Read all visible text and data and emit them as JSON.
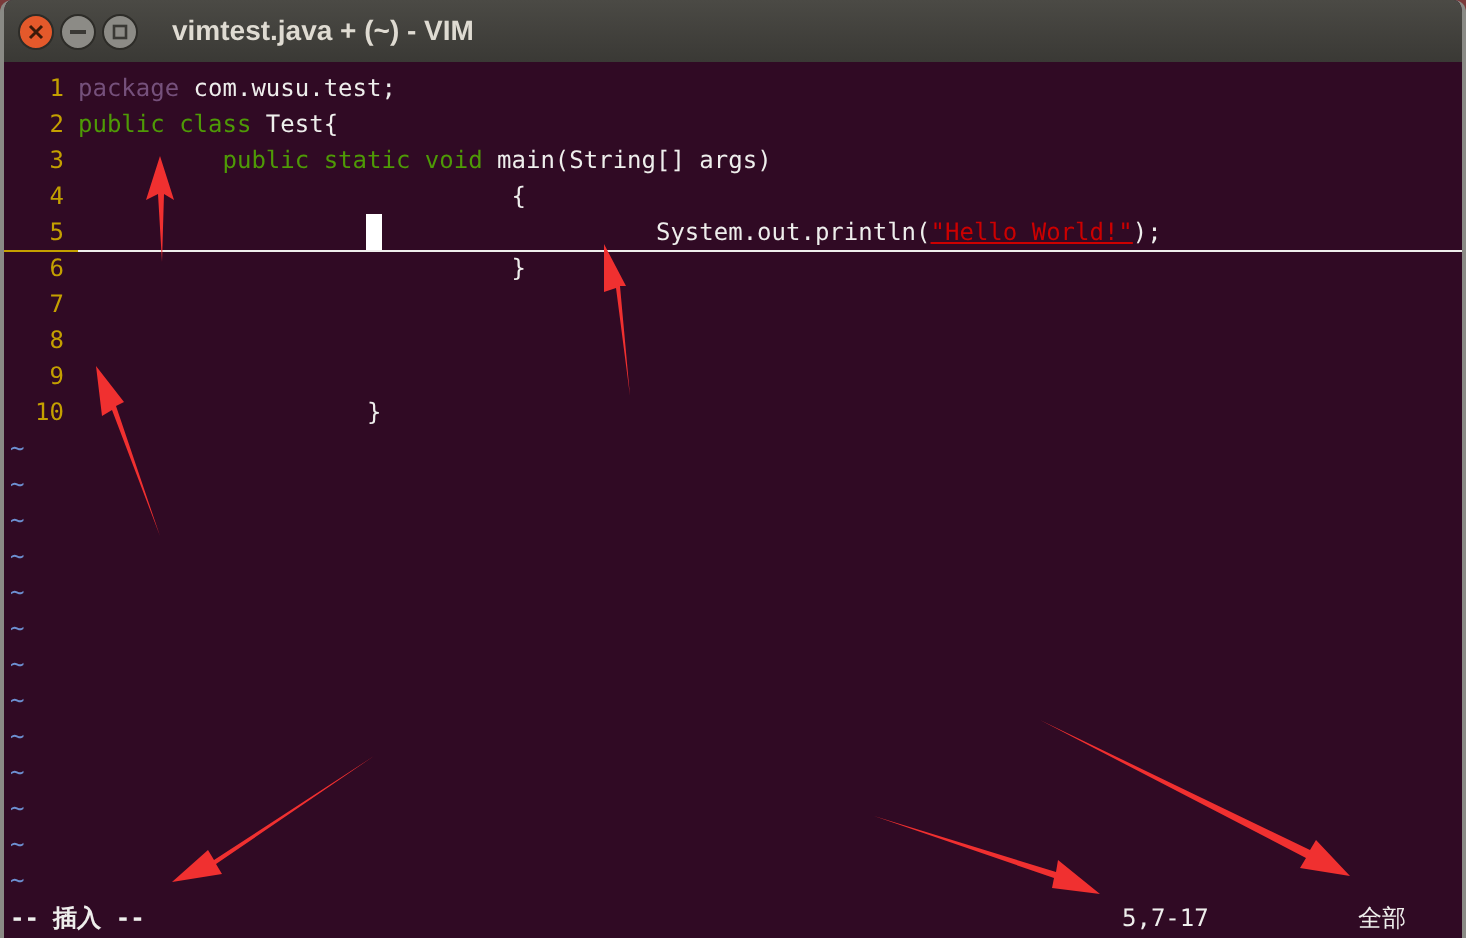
{
  "window": {
    "title": "vimtest.java + (~) - VIM"
  },
  "lines": [
    {
      "number": "1",
      "current": false,
      "segments": [
        {
          "kind": "preproc",
          "text": "package"
        },
        {
          "kind": "plain",
          "text": " com.wusu.test;"
        }
      ]
    },
    {
      "number": "2",
      "current": false,
      "segments": [
        {
          "kind": "keyword",
          "text": "public class"
        },
        {
          "kind": "plain",
          "text": " Test{"
        }
      ]
    },
    {
      "number": "3",
      "current": false,
      "segments": [
        {
          "kind": "keyword",
          "text": "          public static void"
        },
        {
          "kind": "plain",
          "text": " main(String[] args)"
        }
      ]
    },
    {
      "number": "4",
      "current": false,
      "segments": [
        {
          "kind": "plain",
          "text": "                              {"
        }
      ]
    },
    {
      "number": "5",
      "current": true,
      "cursor": true,
      "segments": [
        {
          "kind": "plain",
          "text": "                                        System.out.println("
        },
        {
          "kind": "string",
          "text": "\"Hello World!\""
        },
        {
          "kind": "plain",
          "text": ");"
        }
      ]
    },
    {
      "number": "6",
      "current": false,
      "segments": [
        {
          "kind": "plain",
          "text": "                              }"
        }
      ]
    },
    {
      "number": "7",
      "current": false
    },
    {
      "number": "8",
      "current": false
    },
    {
      "number": "9",
      "current": false
    },
    {
      "number": "10",
      "current": false,
      "segments": [
        {
          "kind": "plain",
          "text": "                    }"
        }
      ]
    }
  ],
  "empty_lines": [
    "~",
    "~",
    "~",
    "~",
    "~",
    "~",
    "~",
    "~",
    "~",
    "~",
    "~",
    "~",
    "~"
  ],
  "status_line": {
    "mode": "-- 插入 --",
    "position": "5,7-17",
    "scroll": "全部"
  }
}
